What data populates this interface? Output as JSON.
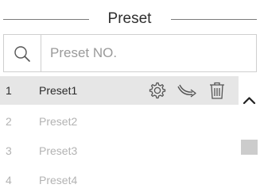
{
  "header": {
    "title": "Preset"
  },
  "search": {
    "icon": "search-icon",
    "placeholder": "Preset NO.",
    "value": ""
  },
  "presets": [
    {
      "index": "1",
      "name": "Preset1",
      "selected": true
    },
    {
      "index": "2",
      "name": "Preset2",
      "selected": false
    },
    {
      "index": "3",
      "name": "Preset3",
      "selected": false
    },
    {
      "index": "4",
      "name": "Preset4",
      "selected": false
    }
  ],
  "row_actions": [
    "gear-icon",
    "call-preset-icon",
    "trash-icon"
  ],
  "colors": {
    "selected_row_bg": "#e6e6e6",
    "dim_text": "#b3b3b3",
    "border": "#cfcfcf",
    "scroll_thumb": "#cccccc"
  }
}
